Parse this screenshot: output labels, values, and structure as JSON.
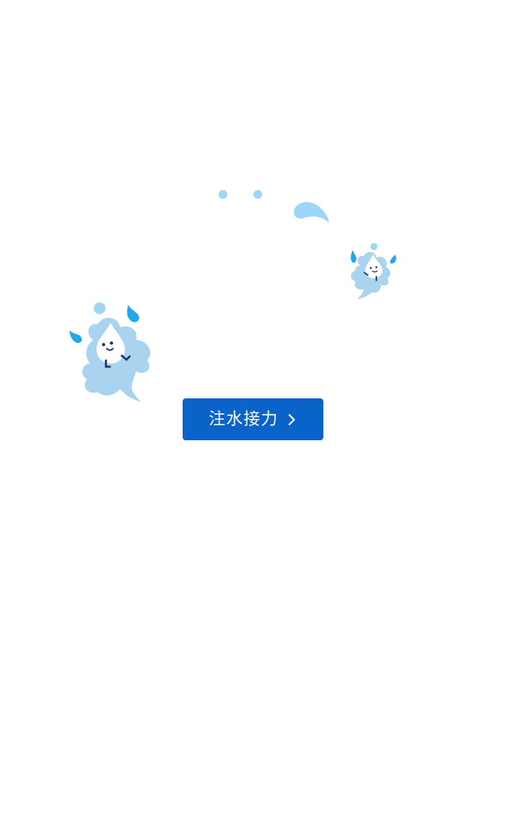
{
  "cta": {
    "label": "注水接力",
    "icon": "chevron-right-icon"
  },
  "colors": {
    "background": "#ffffff",
    "button": "#0a63c9",
    "button_text": "#ffffff",
    "splash_light": "#a9d3ee",
    "droplet": "#1fa8ea",
    "dot": "#9fd5f6"
  },
  "illustration": {
    "icons": [
      "water-splash-character-icon",
      "water-droplet-icon",
      "small-water-splash-character-icon",
      "floating-dot-icon"
    ]
  }
}
